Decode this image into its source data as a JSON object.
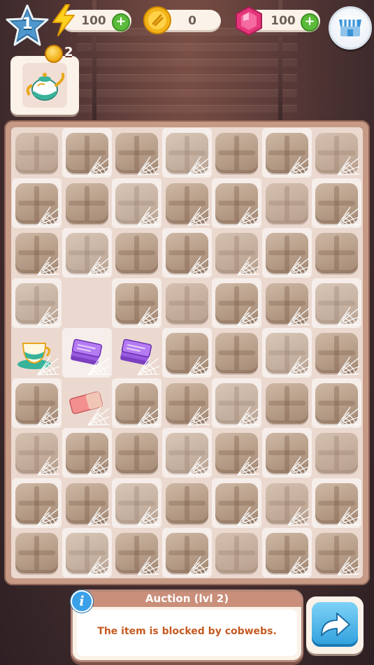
{
  "hud": {
    "level": "1",
    "energy": "100",
    "coins": "0",
    "gems": "100",
    "plus_symbol": "+"
  },
  "order": {
    "item": "teapot",
    "reward": "2"
  },
  "board": {
    "rows": 9,
    "cols": 7,
    "empty_cells": [
      [
        3,
        1
      ]
    ],
    "special_cells": [
      {
        "row": 4,
        "col": 0,
        "item": "teacup"
      },
      {
        "row": 4,
        "col": 1,
        "item": "purple-cards"
      },
      {
        "row": 4,
        "col": 2,
        "item": "purple-cards"
      },
      {
        "row": 5,
        "col": 1,
        "item": "eraser"
      }
    ]
  },
  "info": {
    "title": "Auction (lvl 2)",
    "message": "The item is blocked by cobwebs.",
    "icon_letter": "i"
  },
  "colors": {
    "gem": "#e5367a",
    "plus_button": "#5bbb3a",
    "info_text": "#c65a21",
    "next_button": "#2f9fdc"
  }
}
